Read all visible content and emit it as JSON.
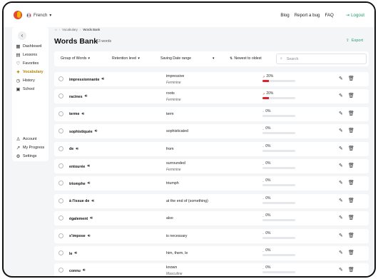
{
  "header": {
    "language": "French",
    "nav": [
      "Blog",
      "Report a bug",
      "FAQ"
    ],
    "logout": "Logout"
  },
  "sidebar": {
    "items": [
      {
        "label": "Dashboard",
        "icon": "dashboard-icon"
      },
      {
        "label": "Lessons",
        "icon": "lessons-icon"
      },
      {
        "label": "Favorites",
        "icon": "heart-icon"
      },
      {
        "label": "Vocabulary",
        "icon": "vocabulary-icon",
        "active": true
      },
      {
        "label": "History",
        "icon": "history-icon"
      },
      {
        "label": "School",
        "icon": "school-icon"
      }
    ],
    "bottom": [
      {
        "label": "Account",
        "icon": "account-icon"
      },
      {
        "label": "My Progress",
        "icon": "progress-icon"
      },
      {
        "label": "Settings",
        "icon": "gear-icon"
      }
    ]
  },
  "breadcrumb": [
    "Vocabulary",
    "Words Bank"
  ],
  "page": {
    "title": "Words Bank",
    "count": "13 words",
    "export": "Export"
  },
  "filters": {
    "group": "Group of Words",
    "retention": "Retention level",
    "date": "Saving Date range",
    "sort": "Newest to oldest",
    "search_placeholder": "Search"
  },
  "colors": {
    "accent_green": "#22a06b",
    "active_gold": "#b38600",
    "retention_red": "#d9232e"
  },
  "words": [
    {
      "word": "impressionnante",
      "translation": "impressive",
      "gender": "Feminine",
      "retention": "20%",
      "retention_value": 0.2,
      "trend": true
    },
    {
      "word": "racines",
      "translation": "roots",
      "gender": "Feminine",
      "retention": "20%",
      "retention_value": 0.2,
      "trend": true
    },
    {
      "word": "terme",
      "translation": "term",
      "gender": "",
      "retention": "0%",
      "retention_value": 0,
      "trend": false
    },
    {
      "word": "sophistiquée",
      "translation": "sophisticated",
      "gender": "",
      "retention": "0%",
      "retention_value": 0,
      "trend": false
    },
    {
      "word": "de",
      "translation": "from",
      "gender": "",
      "retention": "0%",
      "retention_value": 0,
      "trend": false
    },
    {
      "word": "entourée",
      "translation": "surrounded",
      "gender": "Feminine",
      "retention": "0%",
      "retention_value": 0,
      "trend": false
    },
    {
      "word": "triomphe",
      "translation": "triumph",
      "gender": "",
      "retention": "0%",
      "retention_value": 0,
      "trend": false
    },
    {
      "word": "à l'issue de",
      "translation": "at the end of (something)",
      "gender": "",
      "retention": "0%",
      "retention_value": 0,
      "trend": false
    },
    {
      "word": "également",
      "translation": "also",
      "gender": "",
      "retention": "0%",
      "retention_value": 0,
      "trend": false
    },
    {
      "word": "s'impose",
      "translation": "is necessary",
      "gender": "",
      "retention": "0%",
      "retention_value": 0,
      "trend": false
    },
    {
      "word": "le",
      "translation": "him, them, le",
      "gender": "",
      "retention": "0%",
      "retention_value": 0,
      "trend": false
    },
    {
      "word": "connu",
      "translation": "known",
      "gender": "Masculine",
      "retention": "0%",
      "retention_value": 0,
      "trend": false
    }
  ]
}
